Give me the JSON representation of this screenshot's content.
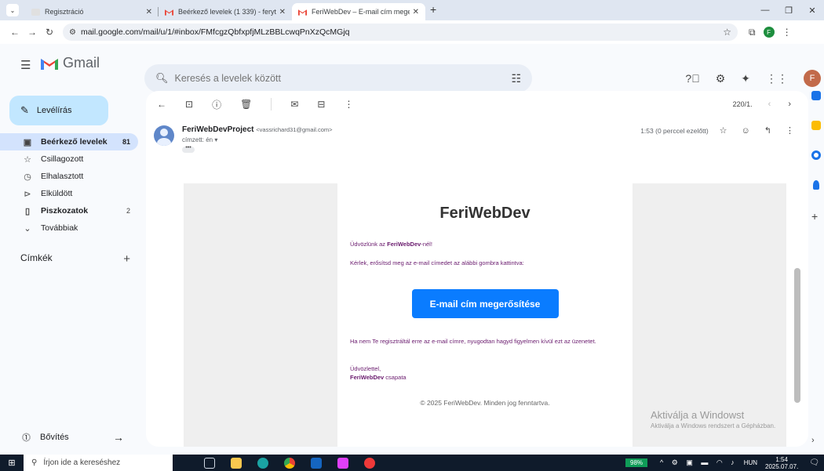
{
  "browser": {
    "tabs": [
      {
        "title": "Regisztráció",
        "active": false
      },
      {
        "title": "Beérkező levelek (1 339) - feryt",
        "active": false
      },
      {
        "title": "FeriWebDev – E-mail cím mege",
        "active": true
      }
    ],
    "new_tab": "+",
    "url": "mail.google.com/mail/u/1/#inbox/FMfcgzQbfxpfjMLzBBLcwqPnXzQcMGjq",
    "profile_initial": "F"
  },
  "gmail": {
    "logo_text": "Gmail",
    "search_placeholder": "Keresés a levelek között",
    "avatar_initial": "F",
    "compose_label": "Levélírás",
    "nav": [
      {
        "label": "Beérkező levelek",
        "count": "81"
      },
      {
        "label": "Csillagozott",
        "count": ""
      },
      {
        "label": "Elhalasztott",
        "count": ""
      },
      {
        "label": "Elküldött",
        "count": ""
      },
      {
        "label": "Piszkozatok",
        "count": "2"
      },
      {
        "label": "Továbbiak",
        "count": ""
      }
    ],
    "labels_header": "Címkék",
    "upgrade_label": "Bővítés"
  },
  "message": {
    "pager": "220/1.",
    "sender_name": "FeriWebDevProject",
    "sender_email": "<vassrichard31@gmail.com>",
    "to_line": "címzett: én ▾",
    "time": "1:53 (0 perccel ezelőtt)",
    "email": {
      "brand": "FeriWebDev",
      "greet_pre": "Üdvözlünk az ",
      "greet_brand": "FeriWebDev",
      "greet_post": "-nél!",
      "ask": "Kérlek, erősítsd meg az e-mail címedet az alábbi gombra kattintva:",
      "cta_label": "E-mail cím megerősítése",
      "ignore": "Ha nem Te regisztráltál erre az e-mail címre, nyugodtan hagyd figyelmen kívül ezt az üzenetet.",
      "regards": "Üdvözlettel,",
      "sig_brand": "FeriWebDev",
      "sig_post": " csapata",
      "footer": "© 2025 FeriWebDev. Minden jog fenntartva."
    }
  },
  "watermark": {
    "line1": "Aktiválja a Windowst",
    "line2": "Aktiválja a Windows rendszert a Gépházban."
  },
  "taskbar": {
    "search_placeholder": "Írjon ide a kereséshez",
    "battery": "98%",
    "lang": "HUN",
    "time": "1:54",
    "date": "2025.07.07."
  },
  "colors": {
    "compose_bg": "#c2e7ff",
    "nav_active_bg": "#d3e3fd",
    "cta": "#0a7cff",
    "email_text": "#6a1b6e",
    "gmail_red": "#ea4335"
  }
}
